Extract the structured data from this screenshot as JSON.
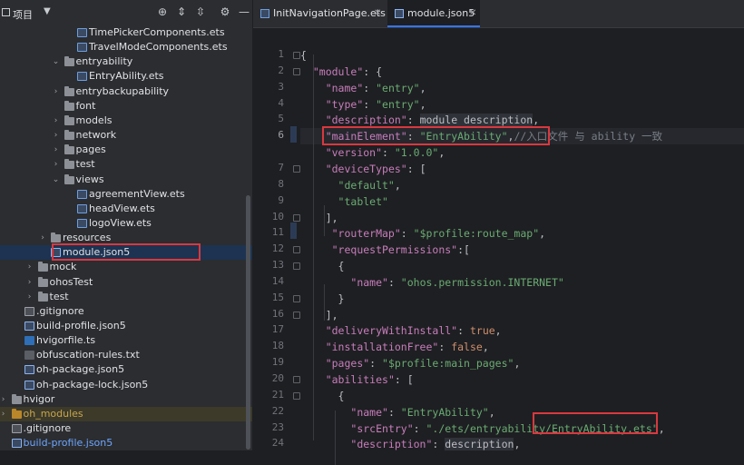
{
  "project_panel": {
    "title": "项目",
    "tree": [
      {
        "label": "TimePickerComponents.ets",
        "icon": "ets-file-icon",
        "arrow": "",
        "indent": 4
      },
      {
        "label": "TravelModeComponents.ets",
        "icon": "ets-file-icon",
        "arrow": "",
        "indent": 4
      },
      {
        "label": "entryability",
        "icon": "folder-icon",
        "arrow": "expanded",
        "indent": 3
      },
      {
        "label": "EntryAbility.ets",
        "icon": "ets-file-icon",
        "arrow": "",
        "indent": 4
      },
      {
        "label": "entrybackupability",
        "icon": "folder-icon",
        "arrow": "collapsed",
        "indent": 3
      },
      {
        "label": "font",
        "icon": "folder-icon",
        "arrow": "",
        "indent": 3
      },
      {
        "label": "models",
        "icon": "folder-icon",
        "arrow": "collapsed",
        "indent": 3
      },
      {
        "label": "network",
        "icon": "folder-icon",
        "arrow": "collapsed",
        "indent": 3
      },
      {
        "label": "pages",
        "icon": "folder-icon",
        "arrow": "collapsed",
        "indent": 3
      },
      {
        "label": "test",
        "icon": "folder-icon",
        "arrow": "collapsed",
        "indent": 3
      },
      {
        "label": "views",
        "icon": "folder-icon",
        "arrow": "expanded",
        "indent": 3
      },
      {
        "label": "agreementView.ets",
        "icon": "ets-file-icon",
        "arrow": "",
        "indent": 4
      },
      {
        "label": "headView.ets",
        "icon": "ets-file-icon",
        "arrow": "",
        "indent": 4
      },
      {
        "label": "logoView.ets",
        "icon": "ets-file-icon",
        "arrow": "",
        "indent": 4
      },
      {
        "label": "resources",
        "icon": "folder-icon",
        "arrow": "collapsed",
        "indent": 2
      },
      {
        "label": "module.json5",
        "icon": "json-file-icon",
        "arrow": "",
        "indent": 2,
        "selected": true
      },
      {
        "label": "mock",
        "icon": "folder-icon",
        "arrow": "collapsed",
        "indent": 1
      },
      {
        "label": "ohosTest",
        "icon": "folder-icon",
        "arrow": "collapsed",
        "indent": 1
      },
      {
        "label": "test",
        "icon": "folder-icon",
        "arrow": "collapsed",
        "indent": 1
      },
      {
        "label": ".gitignore",
        "icon": "gitignore-file-icon",
        "arrow": "",
        "indent": 0
      },
      {
        "label": "build-profile.json5",
        "icon": "json-file-icon",
        "arrow": "",
        "indent": 0
      },
      {
        "label": "hvigorfile.ts",
        "icon": "ts-file-icon",
        "arrow": "",
        "indent": 0
      },
      {
        "label": "obfuscation-rules.txt",
        "icon": "text-file-icon",
        "arrow": "",
        "indent": 0
      },
      {
        "label": "oh-package.json5",
        "icon": "json-file-icon",
        "arrow": "",
        "indent": 0
      },
      {
        "label": "oh-package-lock.json5",
        "icon": "json-file-icon",
        "arrow": "",
        "indent": 0
      },
      {
        "label": "hvigor",
        "icon": "folder-icon",
        "arrow": "collapsed",
        "indent": -1
      },
      {
        "label": "oh_modules",
        "icon": "folder-icon",
        "arrow": "collapsed",
        "indent": -1,
        "excluded": true
      },
      {
        "label": ".gitignore",
        "icon": "gitignore-file-icon",
        "arrow": "",
        "indent": -1
      },
      {
        "label": "build-profile.json5",
        "icon": "json-file-icon",
        "arrow": "",
        "indent": -1,
        "blue": true
      }
    ]
  },
  "editor": {
    "tabs": [
      {
        "label": "InitNavigationPage.ets",
        "active": false
      },
      {
        "label": "module.json5",
        "active": true
      }
    ],
    "current_line": 6,
    "lines": [
      {
        "n": "1",
        "segs": [
          [
            "p",
            "{"
          ]
        ]
      },
      {
        "n": "2",
        "segs": [
          [
            "p",
            "  "
          ],
          [
            "k",
            "\"module\""
          ],
          [
            "p",
            ": {"
          ]
        ]
      },
      {
        "n": "3",
        "segs": [
          [
            "p",
            "    "
          ],
          [
            "k",
            "\"name\""
          ],
          [
            "p",
            ": "
          ],
          [
            "s",
            "\"entry\""
          ],
          [
            "p",
            ","
          ]
        ]
      },
      {
        "n": "4",
        "segs": [
          [
            "p",
            "    "
          ],
          [
            "k",
            "\"type\""
          ],
          [
            "p",
            ": "
          ],
          [
            "s",
            "\"entry\""
          ],
          [
            "p",
            ","
          ]
        ]
      },
      {
        "n": "5",
        "segs": [
          [
            "p",
            "    "
          ],
          [
            "k",
            "\"description\""
          ],
          [
            "p",
            ": "
          ],
          [
            "hint",
            "module description"
          ],
          [
            "p",
            ","
          ]
        ]
      },
      {
        "n": "6",
        "segs": [
          [
            "p",
            "    "
          ],
          [
            "k",
            "\"mainElement\""
          ],
          [
            "p",
            ": "
          ],
          [
            "s",
            "\"EntryAbility\""
          ],
          [
            "p",
            ","
          ],
          [
            "cm",
            "//入口文件 与 ability 一致"
          ]
        ]
      },
      {
        "n": "",
        "segs": [
          [
            "p",
            "    "
          ],
          [
            "k",
            "\"version\""
          ],
          [
            "p",
            ": "
          ],
          [
            "s",
            "\"1.0.0\""
          ],
          [
            "p",
            ","
          ]
        ]
      },
      {
        "n": "7",
        "segs": [
          [
            "p",
            "    "
          ],
          [
            "k",
            "\"deviceTypes\""
          ],
          [
            "p",
            ": ["
          ]
        ]
      },
      {
        "n": "8",
        "segs": [
          [
            "p",
            "      "
          ],
          [
            "s",
            "\"default\""
          ],
          [
            "p",
            ","
          ]
        ]
      },
      {
        "n": "9",
        "segs": [
          [
            "p",
            "      "
          ],
          [
            "s",
            "\"tablet\""
          ]
        ]
      },
      {
        "n": "10",
        "segs": [
          [
            "p",
            "    ],"
          ]
        ]
      },
      {
        "n": "11",
        "segs": [
          [
            "p",
            "     "
          ],
          [
            "k",
            "\"routerMap\""
          ],
          [
            "p",
            ": "
          ],
          [
            "s",
            "\"$profile:route_map\""
          ],
          [
            "p",
            ","
          ]
        ]
      },
      {
        "n": "12",
        "segs": [
          [
            "p",
            "     "
          ],
          [
            "k",
            "\"requestPermissions\""
          ],
          [
            "p",
            ":["
          ]
        ]
      },
      {
        "n": "13",
        "segs": [
          [
            "p",
            "      {"
          ]
        ]
      },
      {
        "n": "14",
        "segs": [
          [
            "p",
            "        "
          ],
          [
            "k",
            "\"name\""
          ],
          [
            "p",
            ": "
          ],
          [
            "s",
            "\"ohos.permission.INTERNET\""
          ]
        ]
      },
      {
        "n": "15",
        "segs": [
          [
            "p",
            "      }"
          ]
        ]
      },
      {
        "n": "16",
        "segs": [
          [
            "p",
            "    ],"
          ]
        ]
      },
      {
        "n": "17",
        "segs": [
          [
            "p",
            "    "
          ],
          [
            "k",
            "\"deliveryWithInstall\""
          ],
          [
            "p",
            ": "
          ],
          [
            "kw",
            "true"
          ],
          [
            "p",
            ","
          ]
        ]
      },
      {
        "n": "18",
        "segs": [
          [
            "p",
            "    "
          ],
          [
            "k",
            "\"installationFree\""
          ],
          [
            "p",
            ": "
          ],
          [
            "kw",
            "false"
          ],
          [
            "p",
            ","
          ]
        ]
      },
      {
        "n": "19",
        "segs": [
          [
            "p",
            "    "
          ],
          [
            "k",
            "\"pages\""
          ],
          [
            "p",
            ": "
          ],
          [
            "s",
            "\"$profile:main_pages\""
          ],
          [
            "p",
            ","
          ]
        ]
      },
      {
        "n": "20",
        "segs": [
          [
            "p",
            "    "
          ],
          [
            "k",
            "\"abilities\""
          ],
          [
            "p",
            ": ["
          ]
        ]
      },
      {
        "n": "21",
        "segs": [
          [
            "p",
            "      {"
          ]
        ]
      },
      {
        "n": "22",
        "segs": [
          [
            "p",
            "        "
          ],
          [
            "k",
            "\"name\""
          ],
          [
            "p",
            ": "
          ],
          [
            "s",
            "\"EntryAbility\""
          ],
          [
            "p",
            ","
          ]
        ]
      },
      {
        "n": "23",
        "segs": [
          [
            "p",
            "        "
          ],
          [
            "k",
            "\"srcEntry\""
          ],
          [
            "p",
            ": "
          ],
          [
            "s",
            "\"./ets/entryability/EntryAbility.ets\""
          ],
          [
            "p",
            ","
          ]
        ]
      },
      {
        "n": "24",
        "segs": [
          [
            "p",
            "        "
          ],
          [
            "k",
            "\"description\""
          ],
          [
            "p",
            ": "
          ],
          [
            "hint",
            "description"
          ],
          [
            "p",
            ","
          ]
        ]
      }
    ]
  }
}
